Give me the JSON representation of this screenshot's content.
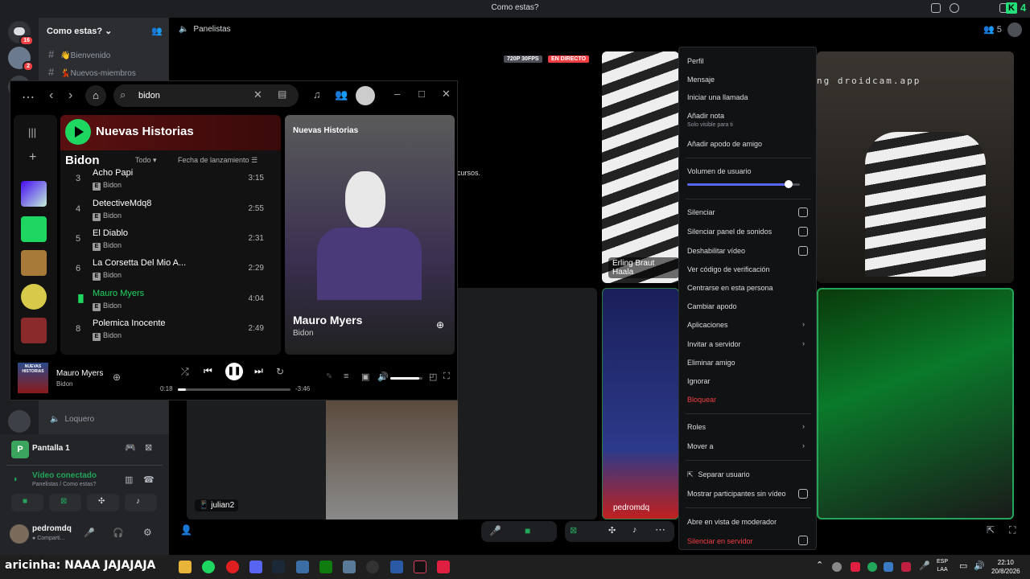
{
  "window": {
    "title": "Como estas?"
  },
  "rail": {
    "badge_top": "16",
    "badge_second": "2",
    "top_right_count": "4"
  },
  "channels": {
    "server_name": "Como estas?",
    "items": [
      {
        "label": "👋Bienvenido"
      },
      {
        "label": "💃Nuevos-miembros"
      }
    ],
    "loquero": "Loquero"
  },
  "voice_channel": {
    "name": "Panelistas",
    "member_count": "5"
  },
  "stream": {
    "quality": "720P 30FPS",
    "live": "EN DIRECTO",
    "watermark": "ng droidcam.app",
    "overlay_text": "cursos."
  },
  "tiles": [
    {
      "name": "Erling Braut Haala"
    },
    {
      "name": "julian2"
    },
    {
      "name": "pedromdq"
    }
  ],
  "context_menu": {
    "items": [
      {
        "label": "Perfil"
      },
      {
        "label": "Mensaje"
      },
      {
        "label": "Iniciar una llamada"
      },
      {
        "label": "Añadir nota",
        "sub": "Solo visible para ti"
      },
      {
        "label": "Añadir apodo de amigo"
      }
    ],
    "volume_label": "Volumen de usuario",
    "volume_level": 0.9,
    "checks": [
      {
        "label": "Silenciar"
      },
      {
        "label": "Silenciar panel de sonidos"
      },
      {
        "label": "Deshabilitar vídeo"
      }
    ],
    "plain": [
      {
        "label": "Ver código de verificación"
      },
      {
        "label": "Centrarse en esta persona"
      },
      {
        "label": "Cambiar apodo"
      }
    ],
    "apps": "Aplicaciones",
    "invite": "Invitar a servidor",
    "remove_friend": "Eliminar amigo",
    "ignore": "Ignorar",
    "block": "Bloquear",
    "roles": "Roles",
    "move": "Mover a",
    "separate": "Separar usuario",
    "show_no_video": "Mostrar participantes sin vídeo",
    "moderator_view": "Abre en vista de moderador",
    "server_mute": "Silenciar en servidor"
  },
  "spotify": {
    "search_value": "bidon",
    "playlist_title": "Nuevas Historias",
    "section_title": "Bidon",
    "filter": "Todo",
    "sort": "Fecha de lanzamiento",
    "tracks": [
      {
        "num": "3",
        "title": "Acho Papi",
        "artist": "Bidon",
        "duration": "3:15"
      },
      {
        "num": "4",
        "title": "DetectiveMdq8",
        "artist": "Bidon",
        "duration": "2:55"
      },
      {
        "num": "5",
        "title": "El Diablo",
        "artist": "Bidon",
        "duration": "2:31"
      },
      {
        "num": "6",
        "title": "La Corsetta Del Mio A...",
        "artist": "Bidon",
        "duration": "2:29"
      },
      {
        "num": "",
        "title": "Mauro Myers",
        "artist": "Bidon",
        "duration": "4:04"
      },
      {
        "num": "8",
        "title": "Polemica Inocente",
        "artist": "Bidon",
        "duration": "2:49"
      }
    ],
    "explicit": "E",
    "now_panel_header": "Nuevas Historias",
    "now_panel_title": "Mauro Myers",
    "now_panel_artist": "Bidon",
    "player": {
      "title": "Mauro Myers",
      "artist": "Bidon",
      "elapsed": "0:18",
      "remaining": "-3:46",
      "progress": 0.07,
      "volume": 0.9
    },
    "cover_text": "NUEVAS HISTORIAS"
  },
  "user_panel": {
    "stream_name": "Pantalla 1",
    "connection_status": "Vídeo conectado",
    "connection_sub": "Panelistas / Como estas?",
    "username": "pedromdq",
    "user_status": "Comparti..."
  },
  "taskbar": {
    "overlay_name": "aricinha",
    "overlay_msg": ": NAAA JAJAJAJA",
    "lang": "ESP",
    "lang2": "LAA",
    "time": "22:10",
    "date": "20/8/2026"
  },
  "colors": {
    "accent_green": "#1ed760",
    "discord_blurple": "#5865f2",
    "danger": "#f23f43"
  }
}
